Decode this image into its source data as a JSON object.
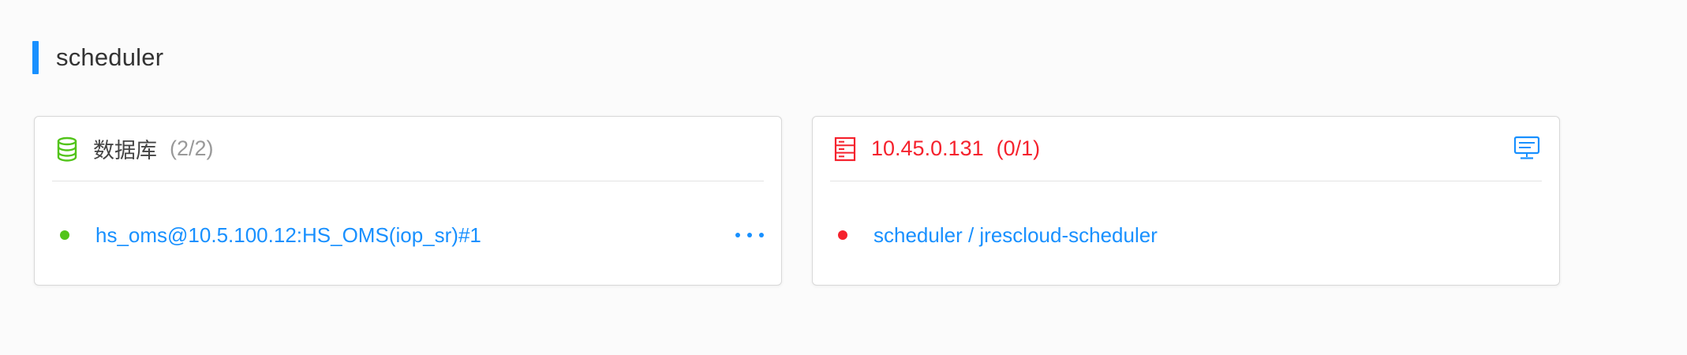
{
  "section": {
    "title": "scheduler"
  },
  "database_card": {
    "icon": "database-icon",
    "title": "数据库",
    "count": "(2/2)",
    "item": {
      "status": "online",
      "status_color": "#52c41a",
      "label": "hs_oms@10.5.100.12:HS_OMS(iop_sr)#1"
    },
    "more_icon": "ellipsis-icon"
  },
  "host_card": {
    "icon": "server-icon",
    "title": "10.45.0.131",
    "count": "(0/1)",
    "title_color": "#f5222d",
    "right_icon": "monitor-icon",
    "item": {
      "status": "offline",
      "status_color": "#f5222d",
      "label": "scheduler / jrescloud-scheduler"
    }
  },
  "colors": {
    "accent": "#1890ff",
    "success": "#52c41a",
    "error": "#f5222d"
  }
}
